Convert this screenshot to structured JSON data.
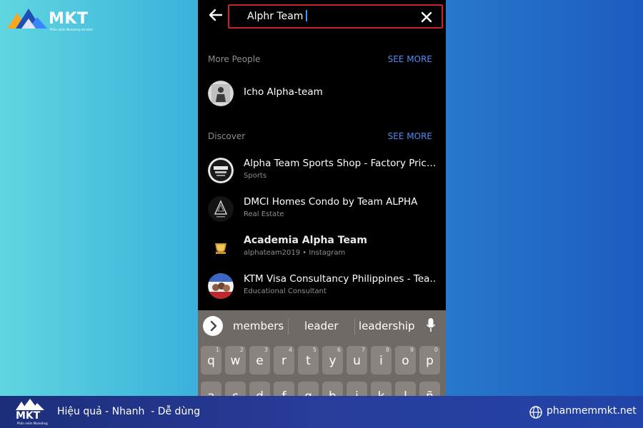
{
  "brand": {
    "name": "MKT",
    "tagline": "Phần mềm Marketing đa kênh"
  },
  "search": {
    "query": "Alphr Team",
    "back_icon": "arrow-left-icon",
    "clear_icon": "close-icon"
  },
  "sections": {
    "more_people": {
      "title": "More People",
      "see_more": "SEE MORE",
      "items": [
        {
          "title": "Icho Alpha-team",
          "subtitle": ""
        }
      ]
    },
    "discover": {
      "title": "Discover",
      "see_more": "SEE MORE",
      "items": [
        {
          "title": "Alpha Team Sports Shop - Factory Pric…",
          "subtitle": "Sports"
        },
        {
          "title": "DMCI Homes Condo by Team ALPHA",
          "subtitle": "Real Estate"
        },
        {
          "title": "Academia Alpha Team",
          "subtitle": "alphateam2019 • Instagram"
        },
        {
          "title": "KTM Visa Consultancy Philippines - Tea…",
          "subtitle": "Educational Consultant"
        }
      ]
    }
  },
  "keyboard": {
    "suggestions": [
      "members",
      "leader",
      "leadership"
    ],
    "expand_icon": "chevron-right-icon",
    "mic_icon": "microphone-icon",
    "row1": [
      {
        "letter": "q",
        "num": "1"
      },
      {
        "letter": "w",
        "num": "2"
      },
      {
        "letter": "e",
        "num": "3"
      },
      {
        "letter": "r",
        "num": "4"
      },
      {
        "letter": "t",
        "num": "5"
      },
      {
        "letter": "y",
        "num": "6"
      },
      {
        "letter": "u",
        "num": "7"
      },
      {
        "letter": "i",
        "num": "8"
      },
      {
        "letter": "o",
        "num": "9"
      },
      {
        "letter": "p",
        "num": "0"
      }
    ],
    "row2": [
      "a",
      "s",
      "d",
      "f",
      "g",
      "h",
      "j",
      "k",
      "l",
      "ñ"
    ]
  },
  "footer": {
    "brand": "MKT",
    "brand_sub": "Phần mềm Marketing",
    "slogan": "Hiệu quả - Nhanh  - Dễ dùng",
    "website": "phanmemmkt.net",
    "globe_icon": "globe-icon"
  },
  "colors": {
    "accent_link": "#4e8cf5",
    "search_border": "#c7242a",
    "footer_bg": "#283c9a"
  }
}
